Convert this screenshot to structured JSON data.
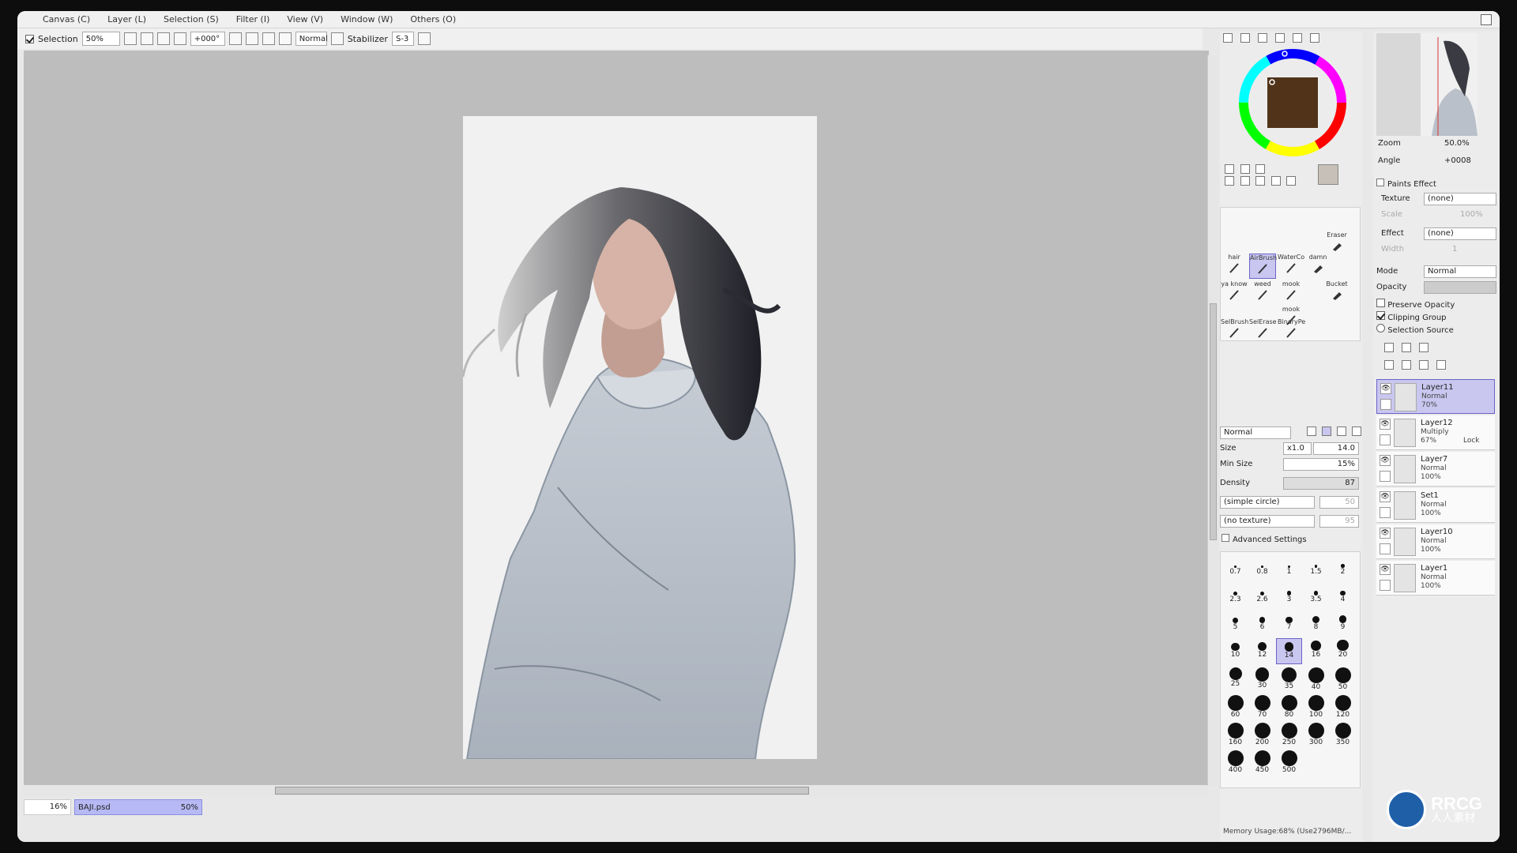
{
  "menu": [
    "Canvas (C)",
    "Layer (L)",
    "Selection (S)",
    "Filter (I)",
    "View (V)",
    "Window (W)",
    "Others (O)"
  ],
  "toolbar": {
    "selection_label": "Selection",
    "zoom": "50%",
    "rotation": "+000°",
    "blend": "Normal",
    "stabilizer_label": "Stabilizer",
    "stabilizer_value": "S-3"
  },
  "statusbar": {
    "nav_zoom": "16%",
    "doc_name": "BAJI.psd",
    "doc_zoom": "50%",
    "memory": "Memory Usage:68% (Use2796MB/..."
  },
  "navigator": {
    "zoom_label": "Zoom",
    "zoom_value": "50.0%",
    "angle_label": "Angle",
    "angle_value": "+0008"
  },
  "paint_effect": {
    "title": "Paints Effect",
    "texture_label": "Texture",
    "texture_value": "(none)",
    "scale_label": "Scale",
    "scale_value": "100%",
    "effect_label": "Effect",
    "effect_value": "(none)",
    "width_label": "Width",
    "width_value": "1"
  },
  "layer_props": {
    "mode_label": "Mode",
    "mode_value": "Normal",
    "opacity_label": "Opacity",
    "preserve_opacity": "Preserve Opacity",
    "clipping_group": "Clipping Group",
    "selection_source": "Selection Source"
  },
  "layers": [
    {
      "name": "Layer11",
      "mode": "Normal",
      "opacity": "70%",
      "extra": "",
      "selected": true
    },
    {
      "name": "Layer12",
      "mode": "Multiply",
      "opacity": "67%",
      "extra": "Lock",
      "selected": false
    },
    {
      "name": "Layer7",
      "mode": "Normal",
      "opacity": "100%",
      "extra": "",
      "selected": false
    },
    {
      "name": "Set1",
      "mode": "Normal",
      "opacity": "100%",
      "extra": "",
      "selected": false
    },
    {
      "name": "Layer10",
      "mode": "Normal",
      "opacity": "100%",
      "extra": "",
      "selected": false
    },
    {
      "name": "Layer1",
      "mode": "Normal",
      "opacity": "100%",
      "extra": "",
      "selected": false
    }
  ],
  "brushes": [
    {
      "label": "Eraser"
    },
    {
      "label": "hair"
    },
    {
      "label": "AirBrush"
    },
    {
      "label": "WaterCo"
    },
    {
      "label": "damn"
    },
    {
      "label": "ya know"
    },
    {
      "label": "weed"
    },
    {
      "label": "mook"
    },
    {
      "label": "Bucket"
    },
    {
      "label": "mook"
    },
    {
      "label": "SelBrush"
    },
    {
      "label": "SelErase"
    },
    {
      "label": "BinaryPe"
    }
  ],
  "tool_settings": {
    "blend": "Normal",
    "size_label": "Size",
    "size_mult": "x1.0",
    "size_value": "14.0",
    "minsize_label": "Min Size",
    "minsize_value": "15%",
    "density_label": "Density",
    "density_value": "87",
    "shape": "(simple circle)",
    "shape_value": "50",
    "texture": "(no texture)",
    "texture_value": "95",
    "advanced": "Advanced Settings"
  },
  "brush_sizes": [
    "0.7",
    "0.8",
    "1",
    "1.5",
    "2",
    "2.3",
    "2.6",
    "3",
    "3.5",
    "4",
    "5",
    "6",
    "7",
    "8",
    "9",
    "10",
    "12",
    "14",
    "16",
    "20",
    "25",
    "30",
    "35",
    "40",
    "50",
    "60",
    "70",
    "80",
    "100",
    "120",
    "160",
    "200",
    "250",
    "300",
    "350",
    "400",
    "450",
    "500"
  ],
  "brush_sizes_selected": "14",
  "watermark": {
    "top": "RRCG",
    "bottom": "人人素材"
  }
}
